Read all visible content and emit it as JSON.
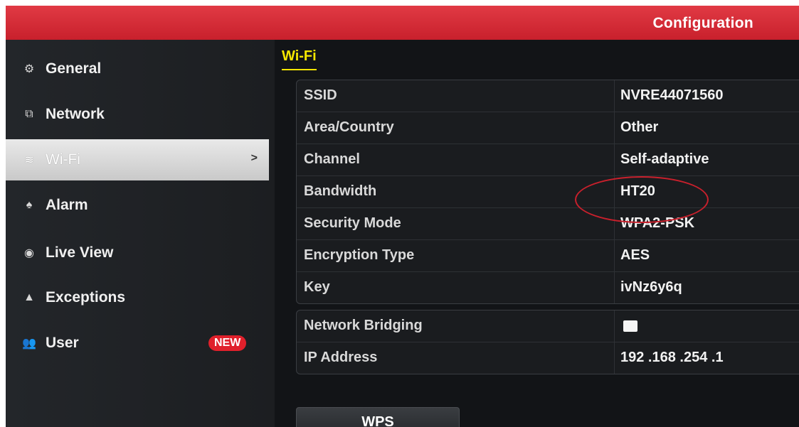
{
  "header": {
    "title": "Configuration"
  },
  "sidebar": {
    "items": [
      {
        "label": "General",
        "icon": "gear-icon"
      },
      {
        "label": "Network",
        "icon": "network-icon"
      },
      {
        "label": "Wi-Fi",
        "icon": "wifi-icon"
      },
      {
        "label": "Alarm",
        "icon": "alarm-icon"
      },
      {
        "label": "Live View",
        "icon": "eye-icon"
      },
      {
        "label": "Exceptions",
        "icon": "warning-icon"
      },
      {
        "label": "User",
        "icon": "users-icon",
        "badge": "NEW"
      }
    ],
    "active_chevron": ">"
  },
  "main": {
    "tab": "Wi-Fi",
    "settings": [
      {
        "key": "SSID",
        "value": "NVRE44071560"
      },
      {
        "key": "Area/Country",
        "value": "Other"
      },
      {
        "key": "Channel",
        "value": "Self-adaptive"
      },
      {
        "key": "Bandwidth",
        "value": "HT20"
      },
      {
        "key": "Security Mode",
        "value": "WPA2-PSK"
      },
      {
        "key": "Encryption Type",
        "value": "AES"
      },
      {
        "key": "Key",
        "value": "ivNz6y6q"
      }
    ],
    "bridging": {
      "label": "Network Bridging",
      "checked": false,
      "ip_label": "IP Address",
      "ip_value": "192 .168 .254 .1"
    },
    "wps_label": "WPS"
  },
  "colors": {
    "header_red": "#d92834",
    "tab_yellow": "#f4e600",
    "badge_red": "#e0202b"
  }
}
